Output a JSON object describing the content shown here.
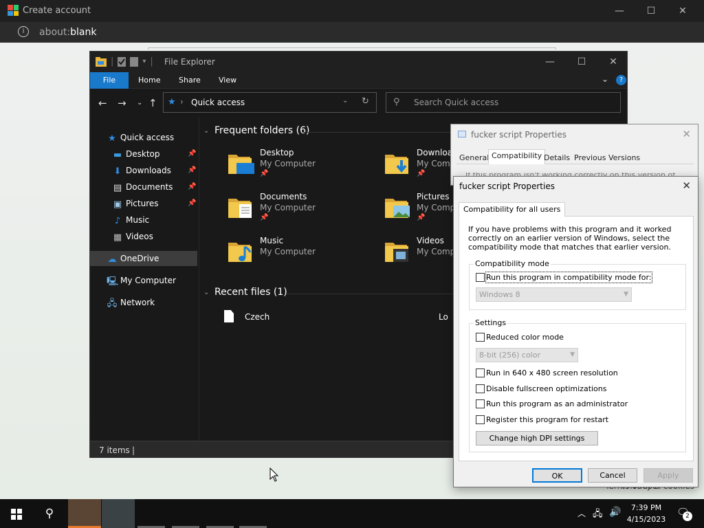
{
  "browser": {
    "title": "Create account",
    "url_prefix": "about:",
    "url_main": "blank",
    "hint_left": "Terms of use",
    "hint_right": "Privacy & cookies",
    "logo_colors": [
      "#e74c3c",
      "#2ecc71",
      "#3498db",
      "#f1c40f"
    ]
  },
  "explorer": {
    "title": "File Explorer",
    "ribbon_tabs": [
      "File",
      "Home",
      "Share",
      "View"
    ],
    "address": "Quick access",
    "search_placeholder": "Search Quick access",
    "sidebar": [
      {
        "label": "Quick access",
        "icon": "star-icon",
        "pinned": false,
        "selected": false
      },
      {
        "label": "Desktop",
        "icon": "desktop-icon",
        "pinned": true
      },
      {
        "label": "Downloads",
        "icon": "download-icon",
        "pinned": true
      },
      {
        "label": "Documents",
        "icon": "document-icon",
        "pinned": true
      },
      {
        "label": "Pictures",
        "icon": "picture-icon",
        "pinned": true
      },
      {
        "label": "Music",
        "icon": "music-icon",
        "pinned": false
      },
      {
        "label": "Videos",
        "icon": "video-icon",
        "pinned": false
      },
      {
        "label": "OneDrive",
        "icon": "cloud-icon",
        "selected": true
      },
      {
        "label": "My Computer",
        "icon": "computer-icon"
      },
      {
        "label": "Network",
        "icon": "network-icon"
      }
    ],
    "frequent_header": "Frequent folders (6)",
    "folders": [
      {
        "name": "Desktop",
        "location": "My Computer",
        "icon": "desktop-folder-icon"
      },
      {
        "name": "Download",
        "location": "My Comp",
        "icon": "downloads-folder-icon"
      },
      {
        "name": "Documents",
        "location": "My Computer",
        "icon": "documents-folder-icon"
      },
      {
        "name": "Pictures",
        "location": "My Comp",
        "icon": "pictures-folder-icon"
      },
      {
        "name": "Music",
        "location": "My Computer",
        "icon": "music-folder-icon"
      },
      {
        "name": "Videos",
        "location": "My Comp",
        "icon": "videos-folder-icon"
      }
    ],
    "recent_header": "Recent files (1)",
    "recent_files": [
      {
        "name": "Czech",
        "location": "Lo"
      }
    ],
    "status": "7 items",
    "accent": "#1979ca"
  },
  "props_back": {
    "title": "fucker script Properties",
    "tabs": [
      "General",
      "Compatibility",
      "Details",
      "Previous Versions"
    ],
    "clipped_text": "If this program isn't working correctly on this version of Windows"
  },
  "props_front": {
    "title": "fucker script Properties",
    "tab": "Compatibility for all users",
    "description": "If you have problems with this program and it worked correctly on an earlier version of Windows, select the compatibility mode that matches that earlier version.",
    "compat_group": "Compatibility mode",
    "compat_check": "Run this program in compatibility mode for:",
    "compat_select": "Windows 8",
    "settings_group": "Settings",
    "reduced_color": "Reduced color mode",
    "color_select": "8-bit (256) color",
    "res640": "Run in 640 x 480 screen resolution",
    "disable_fullscreen": "Disable fullscreen optimizations",
    "run_admin": "Run this program as an administrator",
    "register_restart": "Register this program for restart",
    "dpi_button": "Change high DPI settings",
    "ok": "OK",
    "cancel": "Cancel",
    "apply": "Apply"
  },
  "taskbar": {
    "time": "7:39 PM",
    "date": "4/15/2023",
    "notifications": "2"
  }
}
